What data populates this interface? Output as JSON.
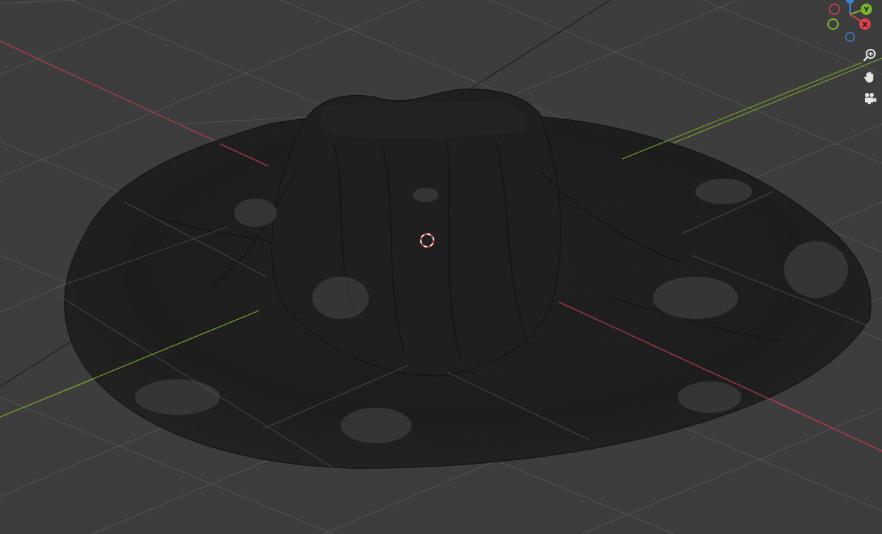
{
  "viewport": {
    "background_color": "#3d3d3d",
    "grid_color": "#555555",
    "x_axis_color": "#b33a48",
    "y_axis_color": "#6f9b2c",
    "mesh_color": "#1e1e1e",
    "mesh_highlight_color": "#3a3a3a",
    "cursor_color": "#e03030"
  },
  "gizmo": {
    "x_label": "X",
    "y_label": "Y",
    "x_color": "#e0414f",
    "y_color": "#78b62b",
    "z_color": "#3b82d9",
    "x_icon": "x-axis-icon",
    "y_icon": "y-axis-icon",
    "z_icon": "z-axis-icon"
  },
  "nav_buttons": {
    "zoom_icon": "zoom-icon",
    "pan_icon": "hand-icon",
    "camera_icon": "camera-icon"
  },
  "object": {
    "name_icon": "volcano-mesh"
  }
}
